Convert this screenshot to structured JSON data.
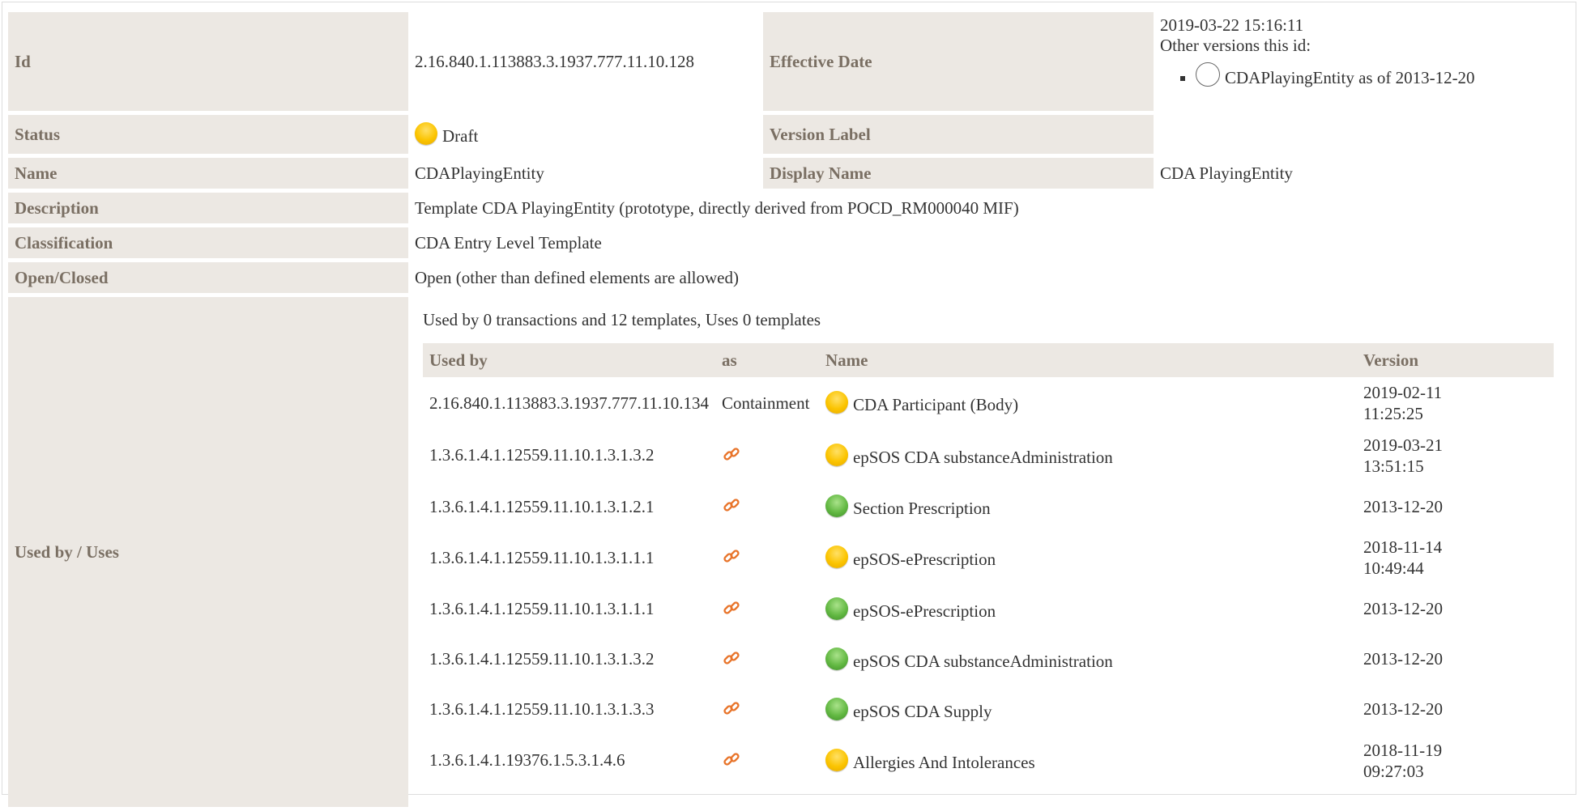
{
  "header": {
    "id_label": "Id",
    "id_value": "2.16.840.1.113883.3.1937.777.11.10.128",
    "effective_label": "Effective Date",
    "effective_value": "2019-03-22 15:16:11",
    "other_versions_label": "Other versions this id:",
    "other_versions": [
      {
        "text": "CDAPlayingEntity as of 2013-12-20",
        "icon": "empty-circle-icon"
      }
    ],
    "status_label": "Status",
    "status_value": "Draft",
    "status_icon": "draft-status-icon",
    "version_label_label": "Version Label",
    "version_label_value": "",
    "name_label": "Name",
    "name_value": "CDAPlayingEntity",
    "display_name_label": "Display Name",
    "display_name_value": "CDA PlayingEntity",
    "description_label": "Description",
    "description_value": "Template CDA PlayingEntity (prototype, directly derived from POCD_RM000040 MIF)",
    "classification_label": "Classification",
    "classification_value": "CDA Entry Level Template",
    "open_closed_label": "Open/Closed",
    "open_closed_value": "Open (other than defined elements are allowed)",
    "used_by_label": "Used by / Uses"
  },
  "usage": {
    "summary": "Used by 0 transactions and 12 templates, Uses 0 templates",
    "columns": [
      "Used by",
      "as",
      "Name",
      "Version"
    ],
    "rows": [
      {
        "used_by": "2.16.840.1.113883.3.1937.777.11.10.134",
        "as": "Containment",
        "status": "draft",
        "name": "CDA Participant (Body)",
        "version": [
          "2019-02-11",
          "11:25:25"
        ]
      },
      {
        "used_by": "1.3.6.1.4.1.12559.11.10.1.3.1.3.2",
        "as": "link",
        "status": "draft",
        "name": "epSOS CDA substanceAdministration",
        "version": [
          "2019-03-21",
          "13:51:15"
        ]
      },
      {
        "used_by": "1.3.6.1.4.1.12559.11.10.1.3.1.2.1",
        "as": "link",
        "status": "final",
        "name": "Section Prescription",
        "version": [
          "2013-12-20"
        ]
      },
      {
        "used_by": "1.3.6.1.4.1.12559.11.10.1.3.1.1.1",
        "as": "link",
        "status": "draft",
        "name": "epSOS-ePrescription",
        "version": [
          "2018-11-14",
          "10:49:44"
        ]
      },
      {
        "used_by": "1.3.6.1.4.1.12559.11.10.1.3.1.1.1",
        "as": "link",
        "status": "final",
        "name": "epSOS-ePrescription",
        "version": [
          "2013-12-20"
        ]
      },
      {
        "used_by": "1.3.6.1.4.1.12559.11.10.1.3.1.3.2",
        "as": "link",
        "status": "final",
        "name": "epSOS CDA substanceAdministration",
        "version": [
          "2013-12-20"
        ]
      },
      {
        "used_by": "1.3.6.1.4.1.12559.11.10.1.3.1.3.3",
        "as": "link",
        "status": "final",
        "name": "epSOS CDA Supply",
        "version": [
          "2013-12-20"
        ]
      },
      {
        "used_by": "1.3.6.1.4.1.19376.1.5.3.1.4.6",
        "as": "link",
        "status": "draft",
        "name": "Allergies And Intolerances",
        "version": [
          "2018-11-19",
          "09:27:03"
        ]
      }
    ]
  },
  "colors": {
    "label_bg": "#ece8e3",
    "label_text": "#7a6f63",
    "draft": "#fbc400",
    "final": "#62b842",
    "link": "#e8742a"
  }
}
